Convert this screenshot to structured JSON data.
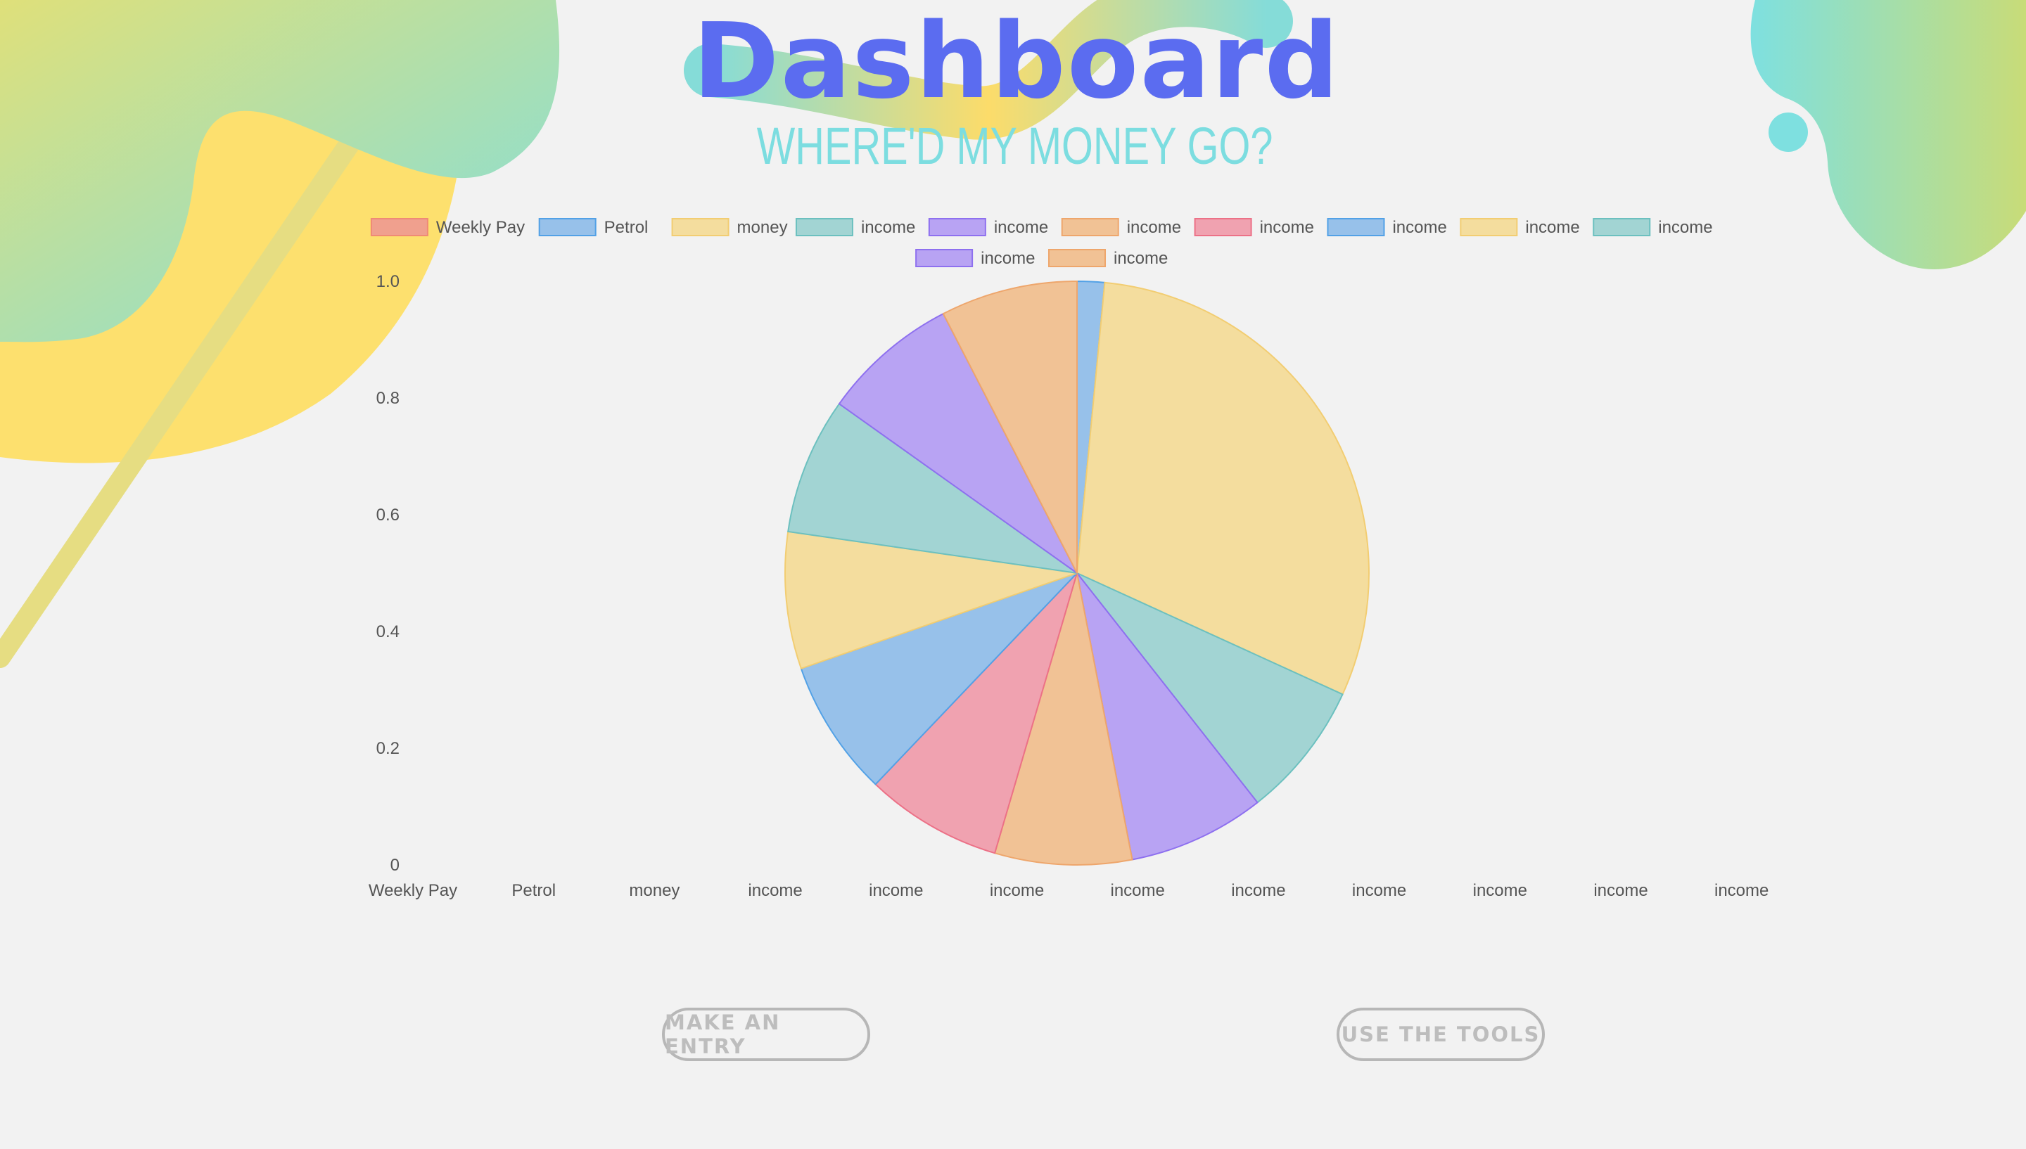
{
  "page": {
    "title": "Dashboard",
    "subtitle": "WHERE'D MY MONEY GO?"
  },
  "buttons": {
    "entry": "MAKE AN ENTRY",
    "tools": "USE THE TOOLS"
  },
  "colors": {
    "title": "#5b6cf0",
    "subtitle": "#7cdde0",
    "background": "#f2f2f2"
  },
  "chart_data": {
    "type": "pie",
    "legend_position": "top",
    "categories": [
      "Weekly Pay",
      "Petrol",
      "money",
      "income",
      "income",
      "income",
      "income",
      "income",
      "income",
      "income",
      "income",
      "income"
    ],
    "values": [
      0,
      1,
      20,
      5,
      5,
      5,
      5,
      5,
      5,
      5,
      5,
      5
    ],
    "y_ticks": [
      "0",
      "0.2",
      "0.4",
      "0.6",
      "0.8",
      "1.0"
    ],
    "ylim": [
      0,
      1
    ],
    "colors": [
      {
        "fill": "#f0a08e",
        "stroke": "#ef8a76"
      },
      {
        "fill": "#97c1ea",
        "stroke": "#52a1e6"
      },
      {
        "fill": "#f4dd9e",
        "stroke": "#f2cd72"
      },
      {
        "fill": "#a2d4d3",
        "stroke": "#6cc0bf"
      },
      {
        "fill": "#b8a3f3",
        "stroke": "#8e70ef"
      },
      {
        "fill": "#f1c295",
        "stroke": "#eea66c"
      },
      {
        "fill": "#f0a2b0",
        "stroke": "#ec7187"
      },
      {
        "fill": "#97c1ea",
        "stroke": "#52a1e6"
      },
      {
        "fill": "#f4dd9e",
        "stroke": "#f2cd72"
      },
      {
        "fill": "#a2d4d3",
        "stroke": "#6cc0bf"
      },
      {
        "fill": "#b8a3f3",
        "stroke": "#8e70ef"
      },
      {
        "fill": "#f1c295",
        "stroke": "#eea66c"
      }
    ]
  }
}
